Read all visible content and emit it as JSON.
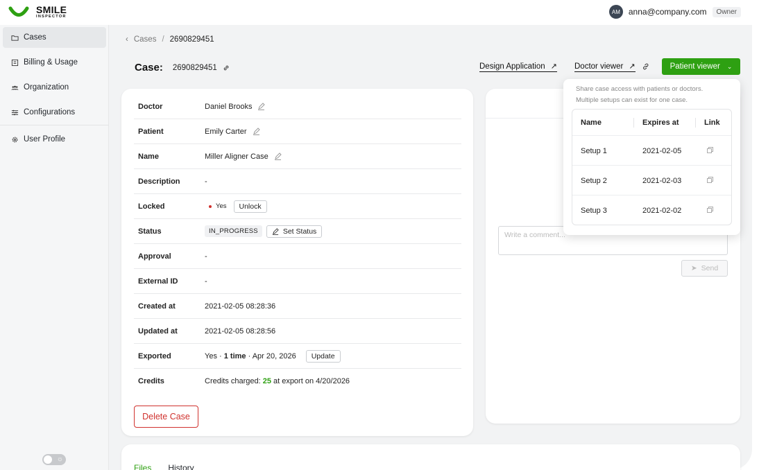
{
  "brand": {
    "line1": "SMILE",
    "line2": "INSPECTOR",
    "color": "#2ea012"
  },
  "user": {
    "initials": "AM",
    "email": "anna@company.com",
    "role": "Owner"
  },
  "sidebar": {
    "items": [
      {
        "label": "Cases",
        "icon": "folder-icon"
      },
      {
        "label": "Billing & Usage",
        "icon": "billing-icon"
      },
      {
        "label": "Organization",
        "icon": "users-icon"
      },
      {
        "label": "Configurations",
        "icon": "sliders-icon"
      },
      {
        "label": "User Profile",
        "icon": "gear-icon"
      }
    ],
    "theme_toggle_icon": "☼"
  },
  "breadcrumb": {
    "back": "‹",
    "parent": "Cases",
    "separator": "/",
    "current": "2690829451"
  },
  "case": {
    "label": "Case:",
    "number": "2690829451"
  },
  "header": {
    "design_app": "Design Application",
    "doctor_viewer": "Doctor viewer",
    "patient_viewer": "Patient viewer",
    "arrow": "↗"
  },
  "details": {
    "doctor": {
      "label": "Doctor",
      "value": "Daniel Brooks"
    },
    "patient": {
      "label": "Patient",
      "value": "Emily Carter"
    },
    "name": {
      "label": "Name",
      "value": "Miller Aligner Case"
    },
    "description": {
      "label": "Description",
      "value": "-"
    },
    "locked": {
      "label": "Locked",
      "value": "Yes",
      "button": "Unlock"
    },
    "status": {
      "label": "Status",
      "value": "IN_PROGRESS",
      "button": "Set Status"
    },
    "approval": {
      "label": "Approval",
      "value": "-"
    },
    "external_id": {
      "label": "External ID",
      "value": "-"
    },
    "created_at": {
      "label": "Created at",
      "value": "2021-02-05 08:28:36"
    },
    "updated_at": {
      "label": "Updated at",
      "value": "2021-02-05 08:28:56"
    },
    "exported": {
      "label": "Exported",
      "value_prefix": "Yes · ",
      "value_bold": "1 time",
      "value_suffix": " · Apr 20, 2026",
      "button": "Update"
    },
    "credits": {
      "label": "Credits",
      "prefix": "Credits charged:",
      "amount": "25",
      "suffix": "at export on 4/20/2026"
    },
    "delete_button": "Delete Case"
  },
  "comments": {
    "placeholder": "Write a comment...",
    "send": "Send"
  },
  "popover": {
    "desc1": "Share case access with patients or doctors.",
    "desc2": "Multiple setups can exist for one case.",
    "headers": {
      "name": "Name",
      "expires": "Expires at",
      "link": "Link"
    },
    "rows": [
      {
        "name": "Setup 1",
        "expires": "2021-02-05"
      },
      {
        "name": "Setup 2",
        "expires": "2021-02-03"
      },
      {
        "name": "Setup 3",
        "expires": "2021-02-02"
      }
    ]
  },
  "tabs": {
    "files": "Files",
    "history": "History"
  }
}
